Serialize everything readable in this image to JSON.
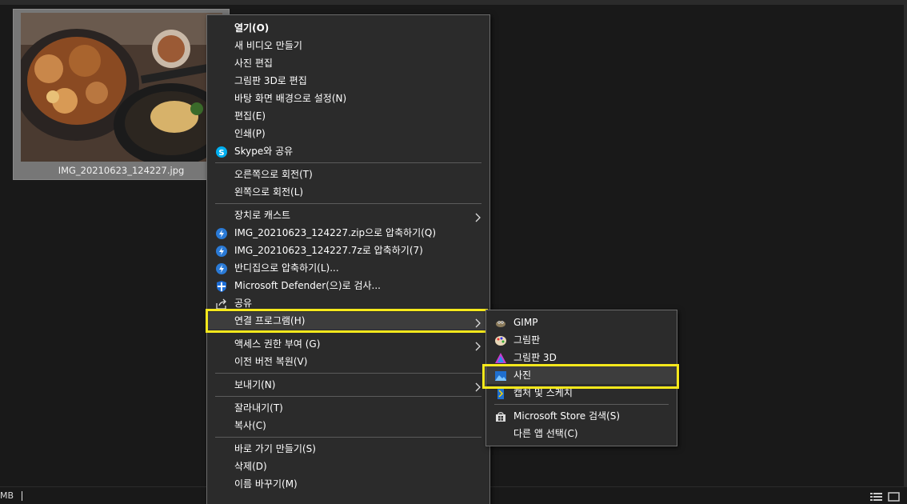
{
  "file": {
    "name": "IMG_20210623_124227.jpg"
  },
  "status": {
    "left": "MB"
  },
  "menu": {
    "open": "열기(O)",
    "new_video": "새 비디오 만들기",
    "edit_photo": "사진 편집",
    "paint3d_edit": "그림판 3D로 편집",
    "set_background": "바탕 화면 배경으로 설정(N)",
    "edit": "편집(E)",
    "print": "인쇄(P)",
    "skype_share": "Skype와 공유",
    "rotate_right": "오른쪽으로 회전(T)",
    "rotate_left": "왼쪽으로 회전(L)",
    "cast": "장치로 캐스트",
    "zip": "IMG_20210623_124227.zip으로 압축하기(Q)",
    "sevenz": "IMG_20210623_124227.7z로 압축하기(7)",
    "bandizip": "반디집으로 압축하기(L)...",
    "defender": "Microsoft Defender(으)로 검사...",
    "share": "공유",
    "open_with": "연결 프로그램(H)",
    "give_access": "액세스 권한 부여 (G)",
    "restore_prev": "이전 버전 복원(V)",
    "send_to": "보내기(N)",
    "cut": "잘라내기(T)",
    "copy": "복사(C)",
    "create_shortcut": "바로 가기 만들기(S)",
    "delete": "삭제(D)",
    "rename": "이름 바꾸기(M)"
  },
  "submenu": {
    "gimp": "GIMP",
    "paint": "그림판",
    "paint3d": "그림판 3D",
    "photos": "사진",
    "snip": "캡처 및 스케치",
    "store": "Microsoft Store 검색(S)",
    "other_app": "다른 앱 선택(C)"
  },
  "colors": {
    "highlight": "#f5e81c",
    "menu_bg": "#2b2b2b",
    "accent": "#1e90ff"
  }
}
